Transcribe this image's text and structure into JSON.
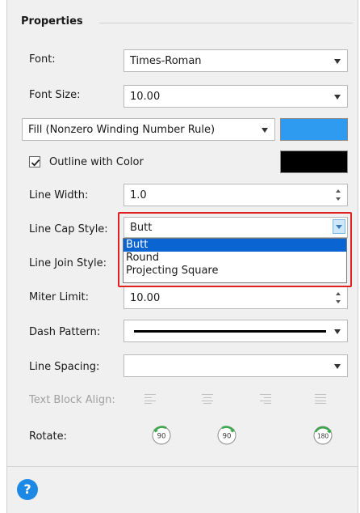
{
  "section": {
    "title": "Properties"
  },
  "font": {
    "label": "Font:",
    "value": "Times-Roman"
  },
  "font_size": {
    "label": "Font Size:",
    "value": "10.00"
  },
  "fill_rule": {
    "value": "Fill (Nonzero Winding Number Rule)",
    "color": "#2f9bf0"
  },
  "outline": {
    "label": "Outline with Color",
    "checked": true,
    "color": "#000000"
  },
  "line_width": {
    "label": "Line Width:",
    "value": "1.0"
  },
  "line_cap": {
    "label": "Line Cap Style:",
    "value": "Butt",
    "options": [
      "Butt",
      "Round",
      "Projecting Square"
    ]
  },
  "line_join": {
    "label": "Line Join Style:"
  },
  "miter_limit": {
    "label": "Miter Limit:",
    "value": "10.00"
  },
  "dash_pattern": {
    "label": "Dash Pattern:"
  },
  "line_spacing": {
    "label": "Line Spacing:",
    "value": ""
  },
  "text_block_align": {
    "label": "Text Block Align:"
  },
  "rotate": {
    "label": "Rotate:",
    "buttons": [
      "90",
      "90",
      "180"
    ]
  },
  "help": {
    "label": "?"
  }
}
